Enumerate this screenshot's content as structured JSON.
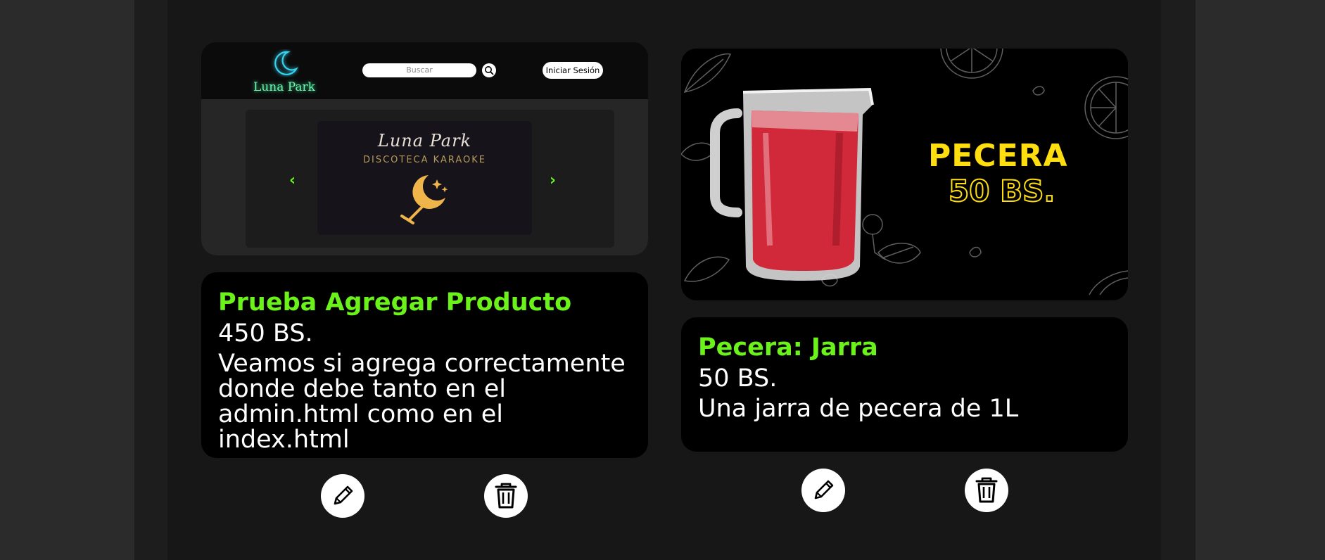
{
  "products": [
    {
      "title": "Prueba Agregar Producto",
      "price": "450 BS.",
      "description": "Veamos si agrega correctamente donde debe tanto en el admin.html como en el index.html",
      "image": {
        "nav": {
          "brand": "Luna Park",
          "search_placeholder": "Buscar",
          "login_label": "Iniciar Sesión"
        },
        "slide": {
          "title": "Luna Park",
          "subtitle": "DISCOTECA KARAOKE"
        },
        "arrow_left": "‹",
        "arrow_right": "›"
      }
    },
    {
      "title": "Pecera: Jarra",
      "price": "50 BS.",
      "description": "Una jarra de pecera de 1L",
      "image": {
        "promo_title": "PECERA",
        "promo_price": "50 BS."
      }
    }
  ],
  "actions": {
    "edit_icon": "pencil-icon",
    "delete_icon": "trash-icon"
  },
  "colors": {
    "accent_green": "#6bf21a",
    "promo_yellow": "#ffde0f",
    "card_bg": "#000000"
  }
}
